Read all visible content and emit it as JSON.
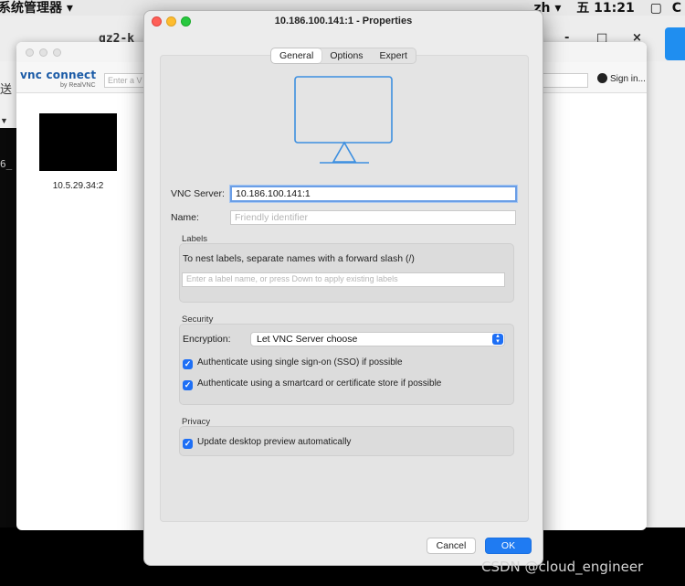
{
  "system_bar": {
    "left_text": "系统管理器 ▾",
    "input_method": "zh ▾",
    "clock": "五 11:21",
    "right_icon": "window-icon",
    "right_edge_char": "C"
  },
  "linux_window": {
    "title": "gz2-k",
    "minimize": "-",
    "maximize": "□",
    "close": "×",
    "left_strip_text": "送",
    "left_strip_arrow": "▼",
    "left_dark_text": "6_"
  },
  "vnc_viewer": {
    "logo": "vnc connect",
    "logo_sub": "by RealVNC",
    "search_placeholder": "Enter a V",
    "sign_in": "Sign in... ▾",
    "thumbnail_label": "10.5.29.34:2"
  },
  "dialog": {
    "title": "10.186.100.141:1 - Properties",
    "tabs": [
      {
        "label": "General",
        "active": true
      },
      {
        "label": "Options",
        "active": false
      },
      {
        "label": "Expert",
        "active": false
      }
    ],
    "vnc_server_label": "VNC Server:",
    "vnc_server_value": "10.186.100.141:1",
    "name_label": "Name:",
    "name_placeholder": "Friendly identifier",
    "labels": {
      "title": "Labels",
      "instructions": "To nest labels, separate names with a forward slash (/)",
      "input_placeholder": "Enter a label name, or press Down to apply existing labels"
    },
    "security": {
      "title": "Security",
      "encryption_label": "Encryption:",
      "encryption_value": "Let VNC Server choose",
      "sso_label": "Authenticate using single sign-on (SSO) if possible",
      "sso_checked": true,
      "smartcard_label": "Authenticate using a smartcard or certificate store if possible",
      "smartcard_checked": true
    },
    "privacy": {
      "title": "Privacy",
      "preview_label": "Update desktop preview automatically",
      "preview_checked": true
    },
    "cancel_label": "Cancel",
    "ok_label": "OK"
  },
  "watermark": "CSDN @cloud_engineer",
  "colors": {
    "accent_blue": "#1f7bf2",
    "monitor_blue": "#3d8fe0",
    "close_red": "#fe5f57",
    "minimize_yellow": "#febc2e",
    "zoom_green": "#28c840"
  }
}
